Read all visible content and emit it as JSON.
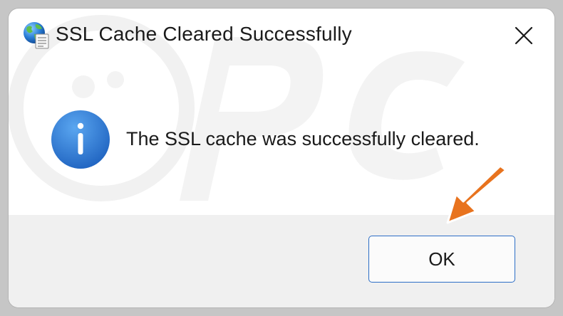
{
  "dialog": {
    "title": "SSL Cache Cleared Successfully",
    "message": "The SSL cache was successfully cleared.",
    "ok_label": "OK",
    "icons": {
      "app": "globe-document-icon",
      "close": "close-icon",
      "info": "info-icon"
    }
  },
  "watermark": {
    "text": "pc risk.com"
  },
  "annotation": {
    "arrow_color": "#e8731e",
    "pointing_to": "ok-button"
  },
  "colors": {
    "accent": "#2d6ec6",
    "info_blue": "#2f7fd6",
    "footer_bg": "#f0f0f0"
  }
}
